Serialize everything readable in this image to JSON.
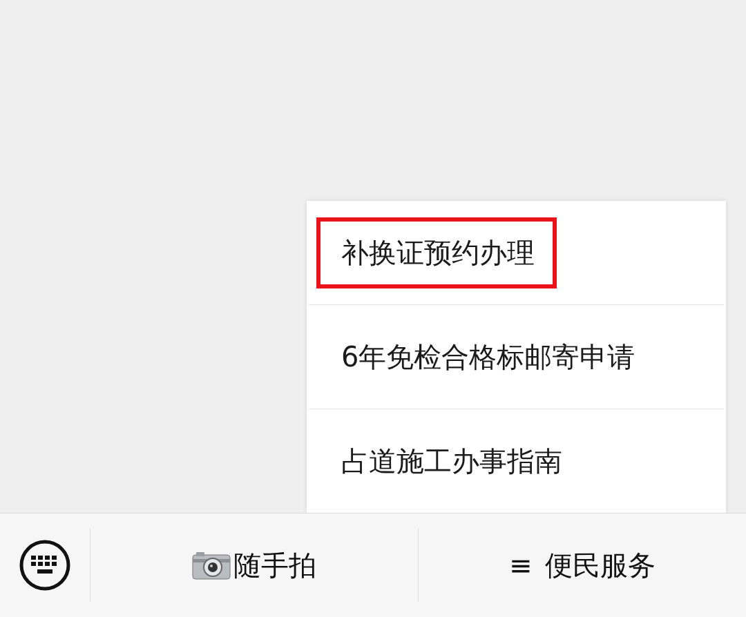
{
  "popup_menu": {
    "items": [
      {
        "label": "补换证预约办理",
        "highlighted": true
      },
      {
        "label": "6年免检合格标邮寄申请",
        "highlighted": false
      },
      {
        "label": "占道施工办事指南",
        "highlighted": false
      }
    ]
  },
  "bottom_menu": {
    "tabs": [
      {
        "kind": "camera",
        "label": "随手拍"
      },
      {
        "kind": "list",
        "glyph": "≡",
        "label": "便民服务"
      }
    ]
  }
}
